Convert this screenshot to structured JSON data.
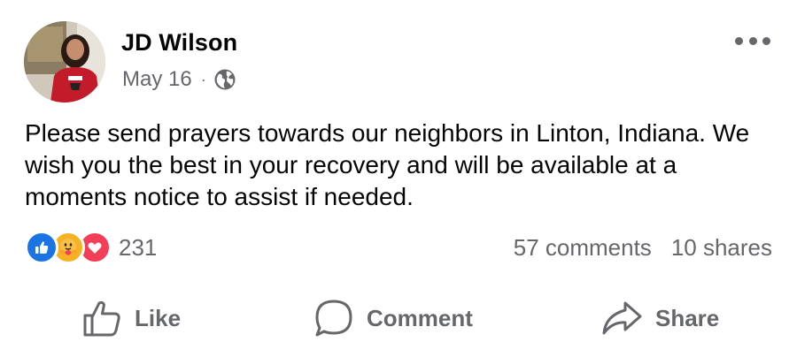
{
  "post": {
    "author": "JD Wilson",
    "date": "May 16",
    "separator": "·",
    "audience_icon": "globe-icon",
    "menu_icon": "more-options-icon",
    "text": "Please send prayers towards our neighbors in Linton, Indiana. We wish you the best in your recovery and will be available at a moments notice to assist if needed.",
    "reactions": {
      "icons": [
        "like-reaction-icon",
        "care-reaction-icon",
        "love-reaction-icon"
      ],
      "count": "231"
    },
    "stats": {
      "comments": "57 comments",
      "shares": "10 shares"
    }
  },
  "actions": {
    "like": "Like",
    "comment": "Comment",
    "share": "Share"
  },
  "colors": {
    "like_blue": "#1b74e4",
    "care_yellow": "#f7b125",
    "love_red": "#f33e58",
    "secondary_text": "#65676b"
  }
}
